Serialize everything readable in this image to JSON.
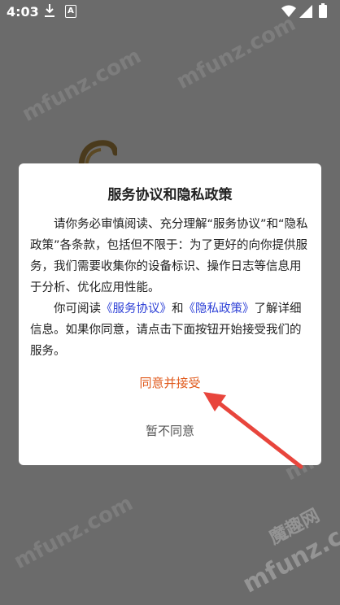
{
  "status_bar": {
    "time": "4:03",
    "notif_icons": [
      "download-icon",
      "a-badge-icon"
    ],
    "right_icons": [
      "wifi-icon",
      "signal-icon",
      "battery-icon"
    ],
    "a_badge": "A"
  },
  "watermark": {
    "text": "mfunz.com",
    "brand": "魔趣网"
  },
  "dialog": {
    "title": "服务协议和隐私政策",
    "para1": "请你务必审慎阅读、充分理解“服务协议”和“隐私政策”各条款，包括但不限于：为了更好的向你提供服务，我们需要收集你的设备标识、操作日志等信息用于分析、优化应用性能。",
    "para2_prefix": "你可阅读",
    "link_service": "《服务协议》",
    "para2_and": "和",
    "link_privacy": "《隐私政策》",
    "para2_suffix": "了解详细信息。如果你同意，请点击下面按钮开始接受我们的服务。",
    "accept_label": "同意并接受",
    "decline_label": "暂不同意"
  },
  "colors": {
    "overlay": "#6b6b6b",
    "accent": "#e05a1c",
    "link": "#2c3fd6",
    "arrow": "#e8453c"
  }
}
